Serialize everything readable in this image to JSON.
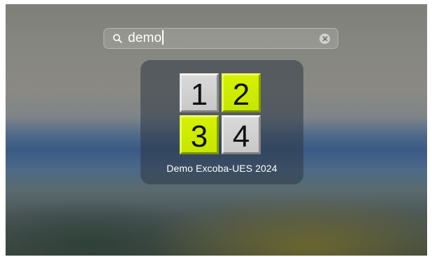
{
  "search": {
    "value": "demo",
    "icon": "search-icon",
    "clear_icon": "clear-icon"
  },
  "results": [
    {
      "label": "Demo Excoba-UES 2024",
      "icon": {
        "cells": [
          "1",
          "2",
          "3",
          "4"
        ],
        "colors": {
          "gray": "#cfcfcf",
          "lime": "#cdee00"
        }
      }
    }
  ]
}
